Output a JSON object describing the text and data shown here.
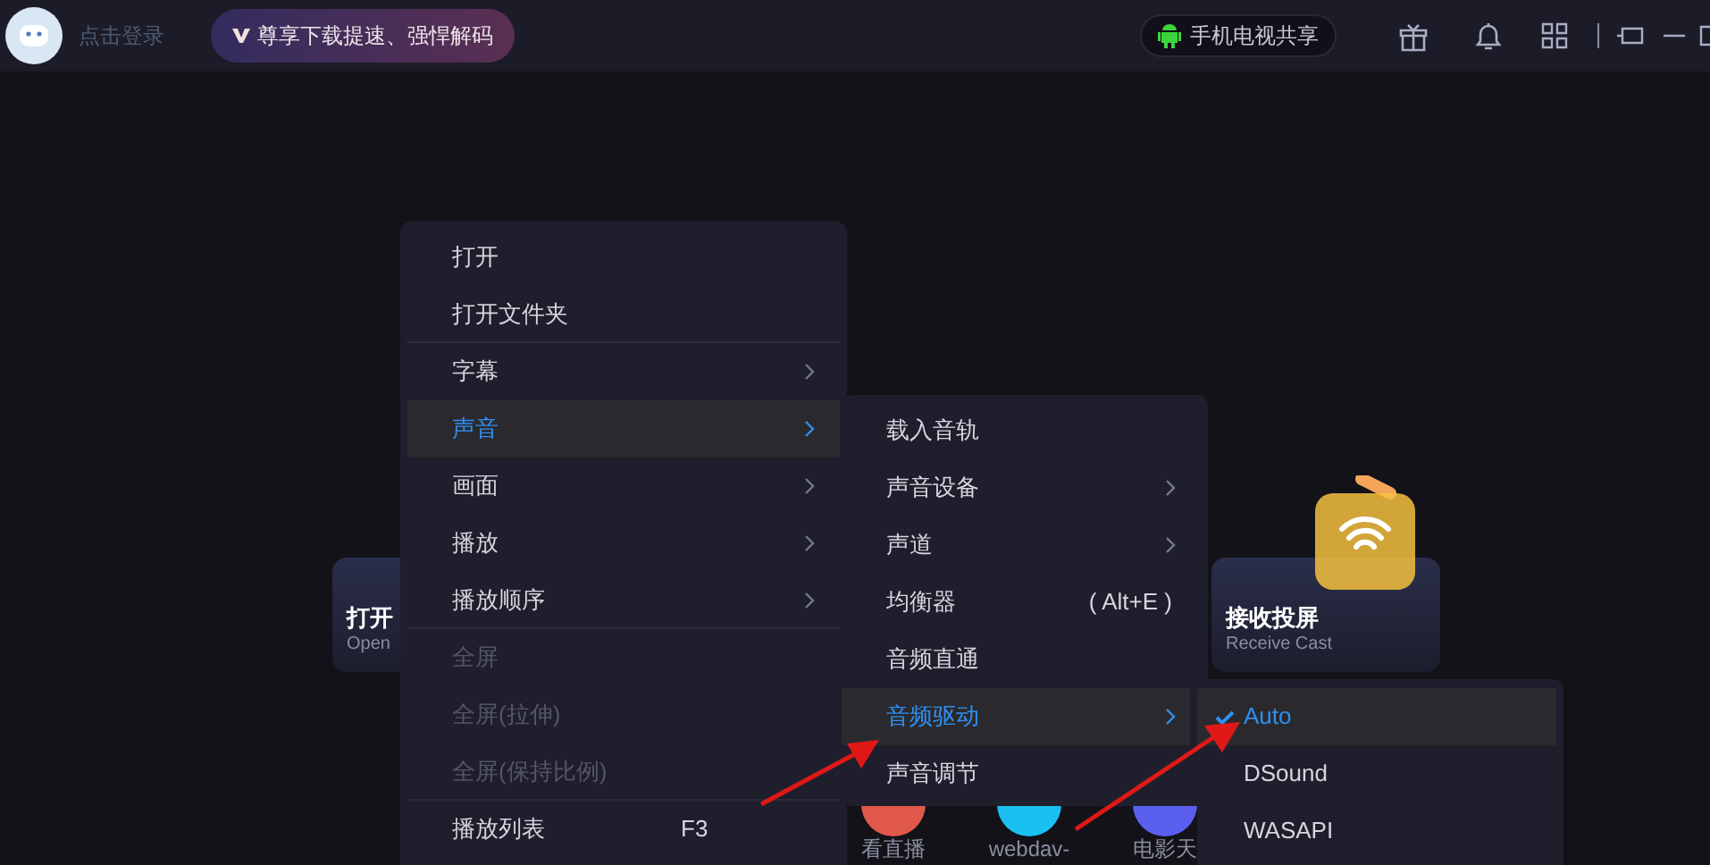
{
  "topbar": {
    "login": "点击登录",
    "vip_banner": "尊享下载提速、强悍解码",
    "phone_share": "手机电视共享"
  },
  "cards": [
    {
      "title": "打开",
      "subtitle": "Open"
    },
    {
      "title": "接收投屏",
      "subtitle": "Receive Cast"
    }
  ],
  "shortcuts": [
    {
      "label": "看直播",
      "color": "#e0584a"
    },
    {
      "label": "webdav-",
      "color": "#19c0f0"
    },
    {
      "label": "电影天",
      "color": "#5b5ff0"
    }
  ],
  "main_menu": [
    {
      "label": "打开",
      "selected": false,
      "disabled": false,
      "submenu": false,
      "divider_after": false
    },
    {
      "label": "打开文件夹",
      "selected": false,
      "disabled": false,
      "submenu": false,
      "divider_after": true
    },
    {
      "label": "字幕",
      "selected": false,
      "disabled": false,
      "submenu": true,
      "divider_after": false
    },
    {
      "label": "声音",
      "selected": true,
      "disabled": false,
      "submenu": true,
      "divider_after": false
    },
    {
      "label": "画面",
      "selected": false,
      "disabled": false,
      "submenu": true,
      "divider_after": false
    },
    {
      "label": "播放",
      "selected": false,
      "disabled": false,
      "submenu": true,
      "divider_after": false
    },
    {
      "label": "播放顺序",
      "selected": false,
      "disabled": false,
      "submenu": true,
      "divider_after": true
    },
    {
      "label": "全屏",
      "selected": false,
      "disabled": true,
      "submenu": false,
      "divider_after": false
    },
    {
      "label": "全屏(拉伸)",
      "selected": false,
      "disabled": true,
      "submenu": false,
      "divider_after": false
    },
    {
      "label": "全屏(保持比例)",
      "selected": false,
      "disabled": true,
      "submenu": false,
      "divider_after": true
    },
    {
      "label": "播放列表",
      "shortcut": "F3",
      "selected": false,
      "disabled": false,
      "submenu": false,
      "divider_after": false
    }
  ],
  "sound_menu": [
    {
      "label": "载入音轨",
      "selected": false,
      "submenu": false
    },
    {
      "label": "声音设备",
      "selected": false,
      "submenu": true
    },
    {
      "label": "声道",
      "selected": false,
      "submenu": true
    },
    {
      "label": "均衡器",
      "shortcut": "( Alt+E )",
      "selected": false,
      "submenu": false
    },
    {
      "label": "音频直通",
      "selected": false,
      "submenu": false
    },
    {
      "label": "音频驱动",
      "selected": true,
      "submenu": true
    },
    {
      "label": "声音调节",
      "selected": false,
      "submenu": false
    }
  ],
  "driver_menu": [
    {
      "label": "Auto",
      "checked": true
    },
    {
      "label": "DSound",
      "checked": false
    },
    {
      "label": "WASAPI",
      "checked": false
    }
  ]
}
